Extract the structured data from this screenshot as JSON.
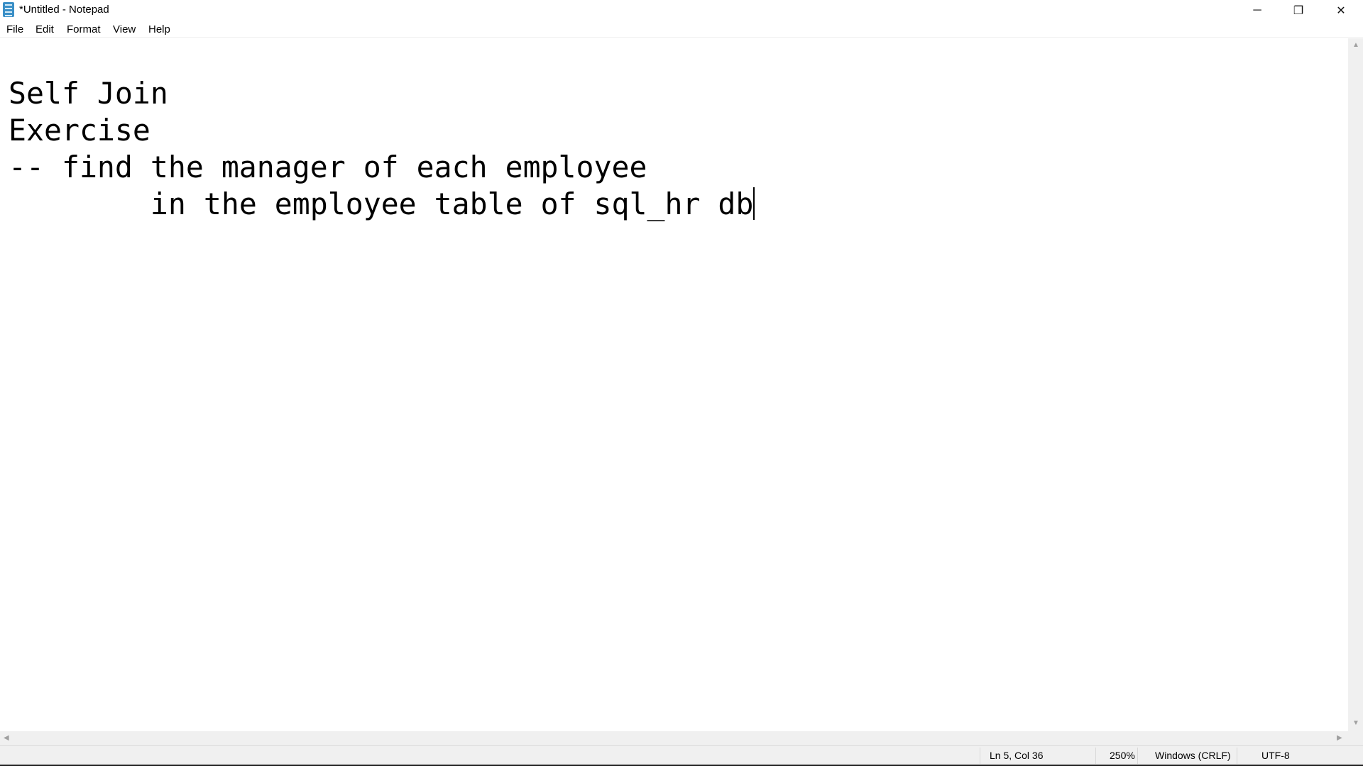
{
  "window": {
    "title": "*Untitled - Notepad",
    "icon": "notepad-icon"
  },
  "controls": {
    "minimize": "─",
    "maximize": "❐",
    "close": "✕"
  },
  "menu": [
    {
      "label": "File"
    },
    {
      "label": "Edit"
    },
    {
      "label": "Format"
    },
    {
      "label": "View"
    },
    {
      "label": "Help"
    }
  ],
  "editor": {
    "lines": [
      "",
      "Self Join",
      "Exercise",
      "-- find the manager of each employee",
      "\tin the employee table of sql_hr db"
    ]
  },
  "status": {
    "position": "Ln 5, Col 36",
    "zoom": "250%",
    "line_ending": "Windows (CRLF)",
    "encoding": "UTF-8"
  }
}
